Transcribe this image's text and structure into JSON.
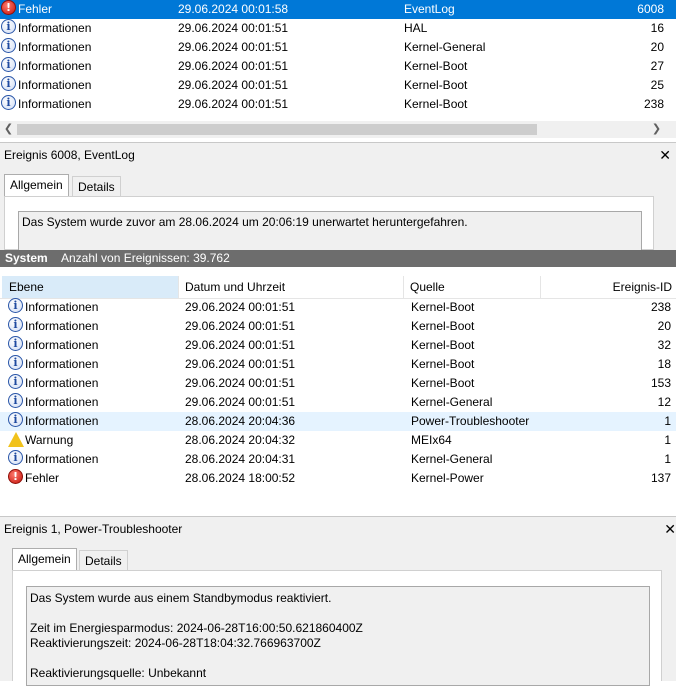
{
  "top_list": {
    "rows": [
      {
        "level": "Fehler",
        "icon": "error",
        "date": "29.06.2024 00:01:58",
        "source": "EventLog",
        "id": "6008",
        "selected": true
      },
      {
        "level": "Informationen",
        "icon": "info",
        "date": "29.06.2024 00:01:51",
        "source": "HAL",
        "id": "16"
      },
      {
        "level": "Informationen",
        "icon": "info",
        "date": "29.06.2024 00:01:51",
        "source": "Kernel-General",
        "id": "20"
      },
      {
        "level": "Informationen",
        "icon": "info",
        "date": "29.06.2024 00:01:51",
        "source": "Kernel-Boot",
        "id": "27"
      },
      {
        "level": "Informationen",
        "icon": "info",
        "date": "29.06.2024 00:01:51",
        "source": "Kernel-Boot",
        "id": "25"
      },
      {
        "level": "Informationen",
        "icon": "info",
        "date": "29.06.2024 00:01:51",
        "source": "Kernel-Boot",
        "id": "238"
      }
    ]
  },
  "top_detail": {
    "title": "Ereignis 6008, EventLog",
    "tabs": [
      "Allgemein",
      "Details"
    ],
    "description": "Das System wurde zuvor am 28.06.2024 um 20:06:19 unerwartet heruntergefahren."
  },
  "system_bar": {
    "title": "System",
    "count": "Anzahl von Ereignissen: 39.762"
  },
  "main_list": {
    "columns": [
      "Ebene",
      "Datum und Uhrzeit",
      "Quelle",
      "Ereignis-ID"
    ],
    "rows": [
      {
        "level": "Informationen",
        "icon": "info",
        "date": "29.06.2024 00:01:51",
        "source": "Kernel-Boot",
        "id": "238"
      },
      {
        "level": "Informationen",
        "icon": "info",
        "date": "29.06.2024 00:01:51",
        "source": "Kernel-Boot",
        "id": "20"
      },
      {
        "level": "Informationen",
        "icon": "info",
        "date": "29.06.2024 00:01:51",
        "source": "Kernel-Boot",
        "id": "32"
      },
      {
        "level": "Informationen",
        "icon": "info",
        "date": "29.06.2024 00:01:51",
        "source": "Kernel-Boot",
        "id": "18"
      },
      {
        "level": "Informationen",
        "icon": "info",
        "date": "29.06.2024 00:01:51",
        "source": "Kernel-Boot",
        "id": "153"
      },
      {
        "level": "Informationen",
        "icon": "info",
        "date": "29.06.2024 00:01:51",
        "source": "Kernel-General",
        "id": "12"
      },
      {
        "level": "Informationen",
        "icon": "info",
        "date": "28.06.2024 20:04:36",
        "source": "Power-Troubleshooter",
        "id": "1",
        "highlighted": true
      },
      {
        "level": "Warnung",
        "icon": "warning",
        "date": "28.06.2024 20:04:32",
        "source": "MEIx64",
        "id": "1"
      },
      {
        "level": "Informationen",
        "icon": "info",
        "date": "28.06.2024 20:04:31",
        "source": "Kernel-General",
        "id": "1"
      },
      {
        "level": "Fehler",
        "icon": "error",
        "date": "28.06.2024 18:00:52",
        "source": "Kernel-Power",
        "id": "137"
      }
    ]
  },
  "bottom_detail": {
    "title": "Ereignis 1, Power-Troubleshooter",
    "tabs": [
      "Allgemein",
      "Details"
    ],
    "lines": [
      "Das System wurde aus einem Standbymodus reaktiviert.",
      "",
      "Zeit im Energiesparmodus: 2024-06-28T16:00:50.621860400Z",
      "Reaktivierungszeit: 2024-06-28T18:04:32.766963700Z",
      "",
      "Reaktivierungsquelle: Unbekannt"
    ]
  },
  "colors": {
    "selection": "#0078d7",
    "highlight": "#e5f3ff",
    "system_bar": "#6d6d6d"
  }
}
